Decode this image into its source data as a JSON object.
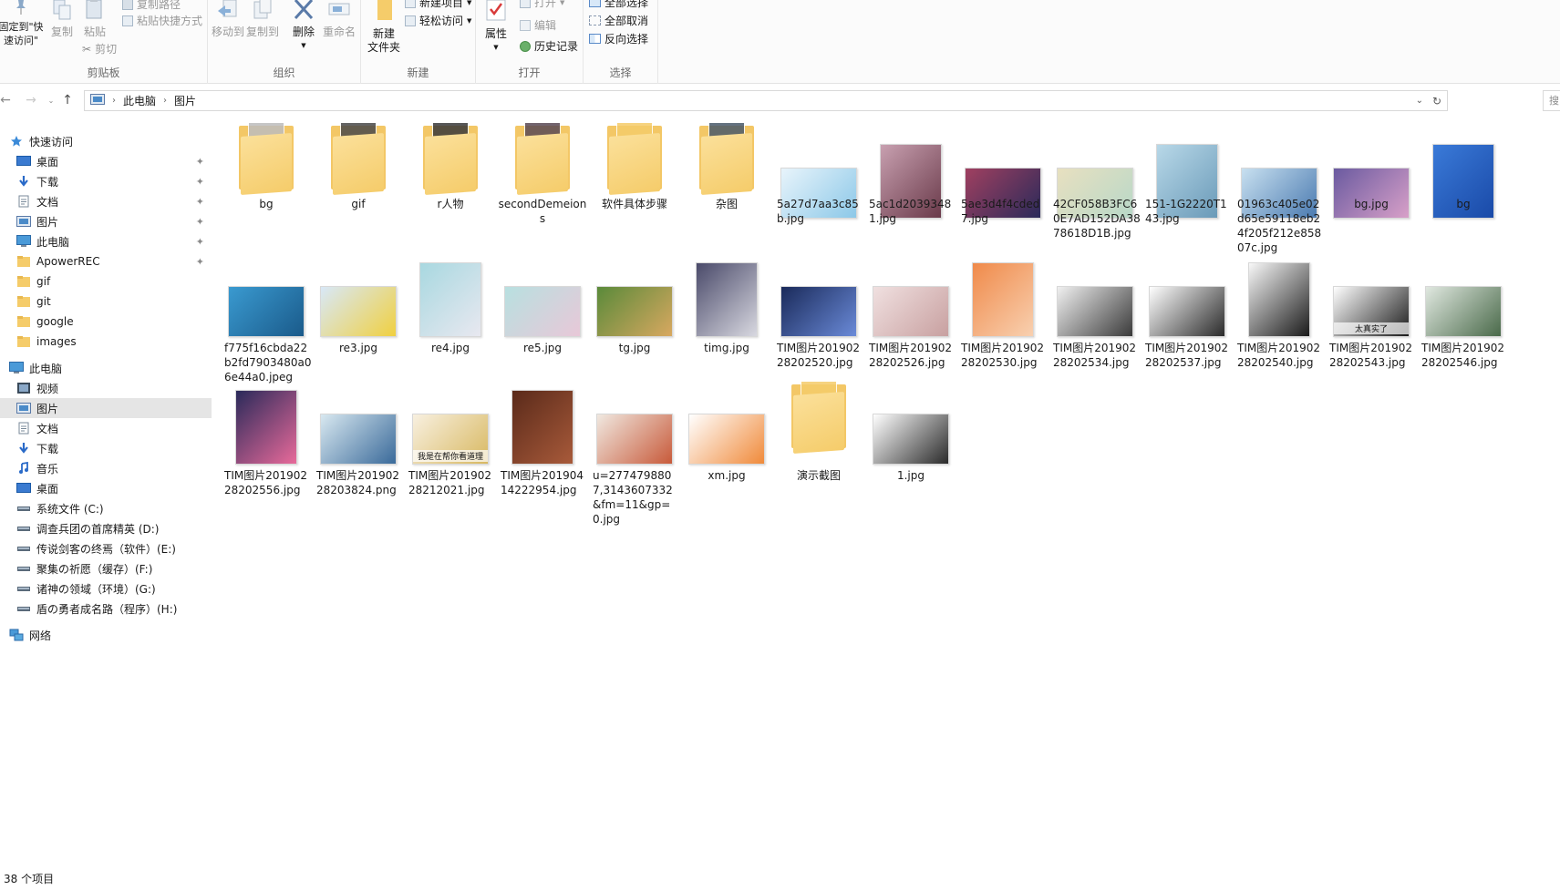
{
  "ribbon": {
    "groups": {
      "clipboard": "剪贴板",
      "organize": "组织",
      "new": "新建",
      "open": "打开",
      "select": "选择"
    },
    "pin_quick": "固定到\"快\n速访问\"",
    "copy": "复制",
    "paste": "粘贴",
    "copy_path": "复制路径",
    "paste_shortcut": "粘贴快捷方式",
    "cut": "剪切",
    "move_to": "移动到",
    "copy_to": "复制到",
    "delete": "删除",
    "rename": "重命名",
    "new_folder": "新建\n文件夹",
    "new_item": "新建项目",
    "easy_access": "轻松访问",
    "properties": "属性",
    "open_btn": "打开",
    "edit": "编辑",
    "history": "历史记录",
    "select_all": "全部选择",
    "select_none": "全部取消",
    "invert_selection": "反向选择"
  },
  "address": {
    "crumbs": [
      "此电脑",
      "图片"
    ],
    "search_placeholder": "搜"
  },
  "sidebar": {
    "items": [
      {
        "label": "快速访问",
        "icon": "star-icon"
      },
      {
        "label": "桌面",
        "icon": "desktop-icon",
        "pinned": true
      },
      {
        "label": "下载",
        "icon": "download-icon",
        "pinned": true
      },
      {
        "label": "文档",
        "icon": "document-icon",
        "pinned": true
      },
      {
        "label": "图片",
        "icon": "pictures-icon",
        "pinned": true
      },
      {
        "label": "此电脑",
        "icon": "computer-icon",
        "pinned": true
      },
      {
        "label": "ApowerREC",
        "icon": "folder-icon",
        "pinned": true
      },
      {
        "label": "gif",
        "icon": "folder-icon"
      },
      {
        "label": "git",
        "icon": "folder-icon"
      },
      {
        "label": "google",
        "icon": "folder-icon"
      },
      {
        "label": "images",
        "icon": "folder-icon"
      },
      {
        "label": "此电脑",
        "icon": "computer-icon"
      },
      {
        "label": "视频",
        "icon": "video-icon"
      },
      {
        "label": "图片",
        "icon": "pictures-icon",
        "selected": true
      },
      {
        "label": "文档",
        "icon": "document-icon"
      },
      {
        "label": "下载",
        "icon": "download-icon"
      },
      {
        "label": "音乐",
        "icon": "music-icon"
      },
      {
        "label": "桌面",
        "icon": "desktop-icon"
      },
      {
        "label": "系统文件 (C:)",
        "icon": "drive-icon"
      },
      {
        "label": "调查兵团の首席精英 (D:)",
        "icon": "drive-icon"
      },
      {
        "label": "传说剑客の终焉（软件）(E:)",
        "icon": "drive-icon"
      },
      {
        "label": "聚集の祈愿（缓存）(F:)",
        "icon": "drive-icon"
      },
      {
        "label": "诸神の领域（环境）(G:)",
        "icon": "drive-icon"
      },
      {
        "label": "盾の勇者成名路（程序）(H:)",
        "icon": "drive-icon"
      },
      {
        "label": "网络",
        "icon": "network-icon"
      }
    ]
  },
  "files": [
    {
      "name": "bg",
      "kind": "folder",
      "accent": "#bdbdbd"
    },
    {
      "name": "gif",
      "kind": "folder",
      "accent": "#4a4a4a"
    },
    {
      "name": "r人物",
      "kind": "folder",
      "accent": "#3a3a3a"
    },
    {
      "name": "secondDemeions",
      "kind": "folder",
      "accent": "#5a4a55"
    },
    {
      "name": "软件具体步骤",
      "kind": "folder",
      "accent": "#f5cc6a"
    },
    {
      "name": "杂图",
      "kind": "folder",
      "accent": "#4a5a6a"
    },
    {
      "name": "5a27d7aa3c85b.jpg",
      "kind": "image",
      "color1": "#e8f4fb",
      "color2": "#8cc8e8"
    },
    {
      "name": "5ac1d20393481.jpg",
      "kind": "image",
      "color1": "#c8a0b0",
      "color2": "#6a3a4a"
    },
    {
      "name": "5ae3d4f4cded7.jpg",
      "kind": "image",
      "color1": "#a04060",
      "color2": "#2a2a5a"
    },
    {
      "name": "42CF058B3FC60E7AD152DA3878618D1B.jpg",
      "kind": "image",
      "color1": "#e8e0c0",
      "color2": "#b8d8c8"
    },
    {
      "name": "151-1G2220T143.jpg",
      "kind": "image",
      "color1": "#b8d8e8",
      "color2": "#6a9ab8"
    },
    {
      "name": "01963c405e02d65e59118eb24f205f212e85807c.jpg",
      "kind": "image",
      "color1": "#c8e0f0",
      "color2": "#4a7ab0"
    },
    {
      "name": "bg.jpg",
      "kind": "image",
      "color1": "#6a5aa0",
      "color2": "#d8a0c8"
    },
    {
      "name": "bg",
      "kind": "image",
      "color1": "#3a7ad8",
      "color2": "#1a4aa8"
    },
    {
      "name": "f775f16cbda22b2fd7903480a06e44a0.jpeg",
      "kind": "image",
      "color1": "#3a9ad0",
      "color2": "#1a5a8a"
    },
    {
      "name": "re3.jpg",
      "kind": "image",
      "color1": "#d8e8f8",
      "color2": "#f0d040"
    },
    {
      "name": "re4.jpg",
      "kind": "image",
      "color1": "#a8d8e0",
      "color2": "#e8e8f0"
    },
    {
      "name": "re5.jpg",
      "kind": "image",
      "color1": "#b8e0e0",
      "color2": "#e8c8d8"
    },
    {
      "name": "tg.jpg",
      "kind": "image",
      "color1": "#5a8a3a",
      "color2": "#d8a860"
    },
    {
      "name": "timg.jpg",
      "kind": "image",
      "color1": "#4a4a6a",
      "color2": "#d8d8e0"
    },
    {
      "name": "TIM图片20190228202520.jpg",
      "kind": "image",
      "color1": "#1a2a5a",
      "color2": "#6a8ad8"
    },
    {
      "name": "TIM图片20190228202526.jpg",
      "kind": "image",
      "color1": "#f0e0e0",
      "color2": "#c8a0a0"
    },
    {
      "name": "TIM图片20190228202530.jpg",
      "kind": "image",
      "color1": "#f08a4a",
      "color2": "#f8d0b0"
    },
    {
      "name": "TIM图片20190228202534.jpg",
      "kind": "image",
      "color1": "#f0f0f0",
      "color2": "#3a3a3a"
    },
    {
      "name": "TIM图片20190228202537.jpg",
      "kind": "image",
      "color1": "#ffffff",
      "color2": "#2a2a2a"
    },
    {
      "name": "TIM图片20190228202540.jpg",
      "kind": "image",
      "color1": "#f8f8f8",
      "color2": "#1a1a1a"
    },
    {
      "name": "TIM图片20190228202543.jpg",
      "kind": "image",
      "color1": "#ffffff",
      "color2": "#1a1a1a",
      "caption": "太真实了"
    },
    {
      "name": "TIM图片20190228202546.jpg",
      "kind": "image",
      "color1": "#e0e8e0",
      "color2": "#4a6a4a"
    },
    {
      "name": "TIM图片20190228202556.jpg",
      "kind": "image",
      "color1": "#2a2a5a",
      "color2": "#e86a9a"
    },
    {
      "name": "TIM图片20190228203824.png",
      "kind": "image",
      "color1": "#d8e8f0",
      "color2": "#3a6a9a"
    },
    {
      "name": "TIM图片20190228212021.jpg",
      "kind": "image",
      "color1": "#f8f0e0",
      "color2": "#d8b860",
      "caption": "我是在帮你看道理"
    },
    {
      "name": "TIM图片20190414222954.jpg",
      "kind": "image",
      "color1": "#5a2a1a",
      "color2": "#a85a3a"
    },
    {
      "name": "u=2774798807,3143607332&fm=11&gp=0.jpg",
      "kind": "image",
      "color1": "#f0e8e0",
      "color2": "#c85a3a"
    },
    {
      "name": "xm.jpg",
      "kind": "image",
      "color1": "#ffffff",
      "color2": "#f08a3a"
    },
    {
      "name": "演示截图",
      "kind": "folder",
      "accent": "#f5cc6a"
    },
    {
      "name": "1.jpg",
      "kind": "image",
      "color1": "#ffffff",
      "color2": "#2a2a2a"
    }
  ],
  "status": {
    "count": "38 个项目"
  },
  "colors": {
    "folder": "#f5cc6a",
    "selected_bg": "#e5e5e5",
    "accent_blue": "#1e6fc8"
  }
}
